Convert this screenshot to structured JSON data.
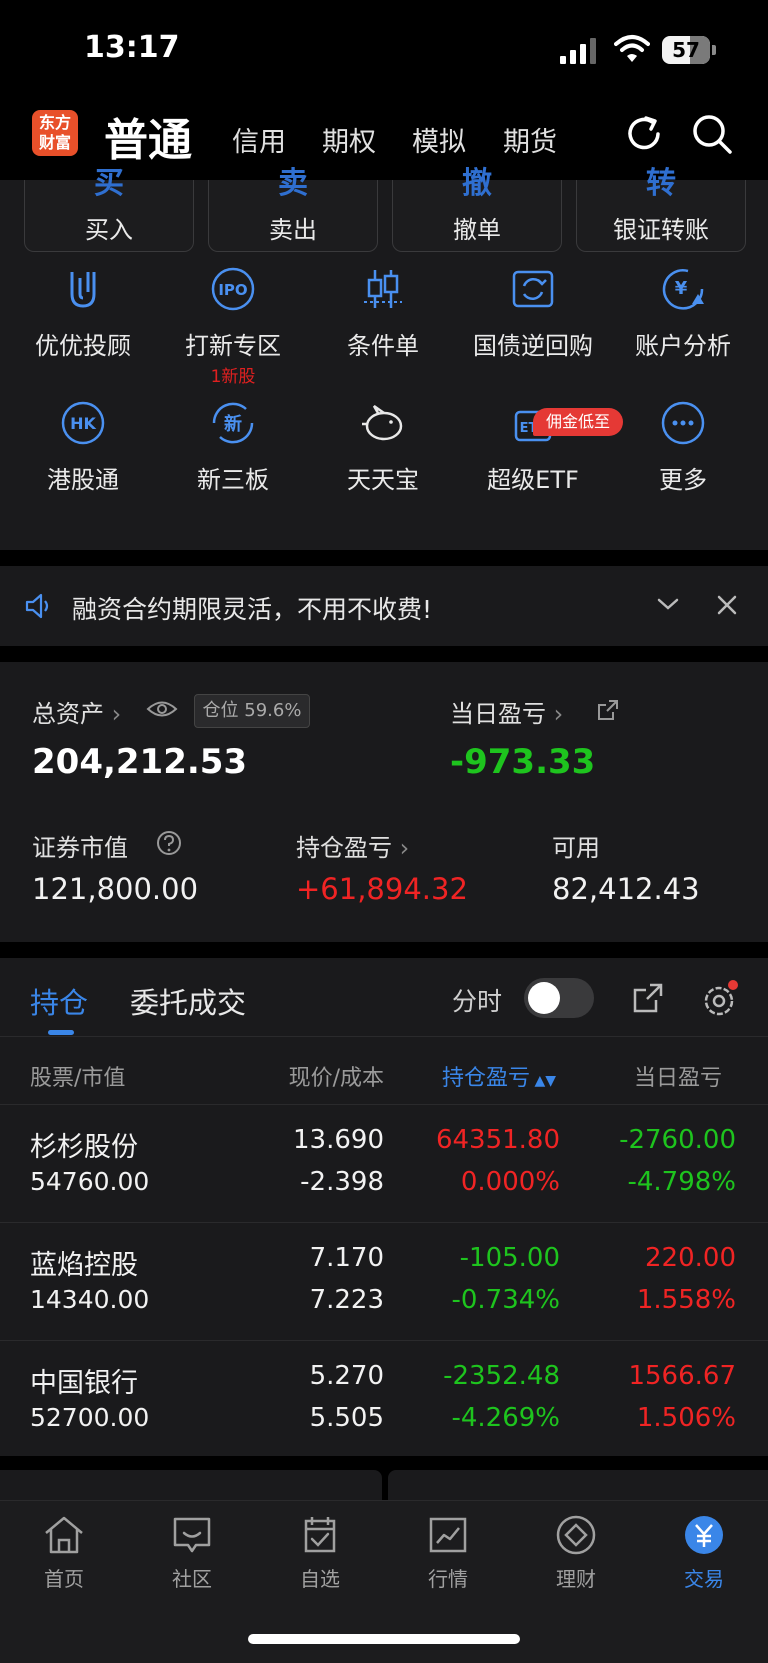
{
  "status_bar": {
    "time": "13:17",
    "battery": "57"
  },
  "header": {
    "logo": [
      "东方",
      "财富"
    ],
    "mode": "普通",
    "tabs": [
      "信用",
      "期权",
      "模拟",
      "期货"
    ]
  },
  "quick_actions": [
    {
      "glyph": "买",
      "label": "买入"
    },
    {
      "glyph": "卖",
      "label": "卖出"
    },
    {
      "glyph": "撤",
      "label": "撤单"
    },
    {
      "glyph": "转",
      "label": "银证转账"
    }
  ],
  "grid": [
    {
      "label": "优优投顾",
      "icon": "uu-advisor-icon"
    },
    {
      "label": "打新专区",
      "icon": "ipo-icon",
      "sub": "1新股",
      "icon_text": "IPO"
    },
    {
      "label": "条件单",
      "icon": "candlestick-icon"
    },
    {
      "label": "国债逆回购",
      "icon": "repo-icon"
    },
    {
      "label": "账户分析",
      "icon": "account-analysis-icon",
      "icon_text": "¥"
    },
    {
      "label": "港股通",
      "icon": "hk-icon",
      "icon_text": "HK"
    },
    {
      "label": "新三板",
      "icon": "neeq-icon",
      "icon_text": "新"
    },
    {
      "label": "天天宝",
      "icon": "piggy-bank-icon"
    },
    {
      "label": "超级ETF",
      "icon": "etf-icon",
      "icon_text": "ETF"
    },
    {
      "label": "更多",
      "icon": "more-icon"
    }
  ],
  "promo_badge": "佣金低至",
  "notice": {
    "text": "融资合约期限灵活，不用不收费!"
  },
  "assets": {
    "total_label": "总资产",
    "position_badge": "仓位 59.6%",
    "total_value": "204,212.53",
    "daily_pl_label": "当日盈亏",
    "daily_pl_value": "-973.33",
    "market_value_label": "证券市值",
    "market_value": "121,800.00",
    "holding_pl_label": "持仓盈亏",
    "holding_pl_value": "+61,894.32",
    "available_label": "可用",
    "available_value": "82,412.43"
  },
  "holdings": {
    "tab_active": "持仓",
    "tab_inactive": "委托成交",
    "fenshi": "分时",
    "columns": [
      "股票/市值",
      "现价/成本",
      "持仓盈亏",
      "当日盈亏"
    ],
    "rows": [
      {
        "name": "杉杉股份",
        "mv": "54760.00",
        "price": "13.690",
        "cost": "-2.398",
        "hpl": "64351.80",
        "hpl_pct": "0.000%",
        "dpl": "-2760.00",
        "dpl_pct": "-4.798%"
      },
      {
        "name": "蓝焰控股",
        "mv": "14340.00",
        "price": "7.170",
        "cost": "7.223",
        "hpl": "-105.00",
        "hpl_pct": "-0.734%",
        "dpl": "220.00",
        "dpl_pct": "1.558%"
      },
      {
        "name": "中国银行",
        "mv": "52700.00",
        "price": "5.270",
        "cost": "5.505",
        "hpl": "-2352.48",
        "hpl_pct": "-4.269%",
        "dpl": "1566.67",
        "dpl_pct": "1.506%"
      }
    ]
  },
  "nav": [
    {
      "label": "首页",
      "icon": "home-icon"
    },
    {
      "label": "社区",
      "icon": "community-icon"
    },
    {
      "label": "自选",
      "icon": "watchlist-icon"
    },
    {
      "label": "行情",
      "icon": "market-icon"
    },
    {
      "label": "理财",
      "icon": "wealth-icon"
    },
    {
      "label": "交易",
      "icon": "trade-icon",
      "active": true
    }
  ],
  "colors": {
    "accent": "#3a86e8",
    "up": "#f02424",
    "down": "#1ec41e",
    "logo": "#e8502a"
  }
}
